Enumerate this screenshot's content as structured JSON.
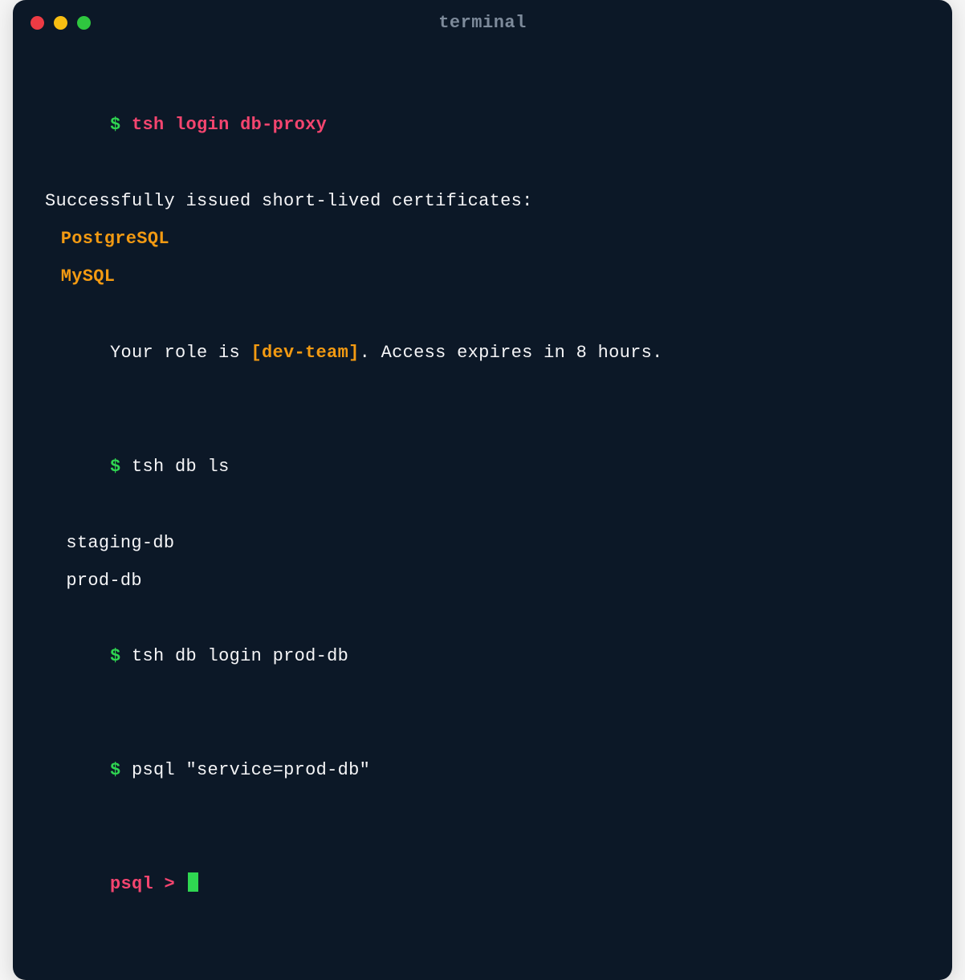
{
  "window": {
    "title": "terminal"
  },
  "session": {
    "prompt": "$",
    "cmd1": "tsh login db-proxy",
    "output1": "Successfully issued short-lived certificates:",
    "certs": [
      "PostgreSQL",
      "MySQL"
    ],
    "role_pre": "Your role is ",
    "role_bracket": "[dev-team]",
    "role_post": ". Access expires in 8 hours.",
    "cmd2": "tsh db ls",
    "dbs": [
      "staging-db",
      "prod-db"
    ],
    "cmd3": "tsh db login prod-db",
    "cmd4": "psql \"service=prod-db\"",
    "psql_prompt": "psql > "
  },
  "colors": {
    "bg": "#0c1827",
    "prompt": "#2fd651",
    "accent": "#f4456f",
    "orange": "#f39a12",
    "text": "#f5f5f7",
    "title": "#7d8a9a"
  }
}
